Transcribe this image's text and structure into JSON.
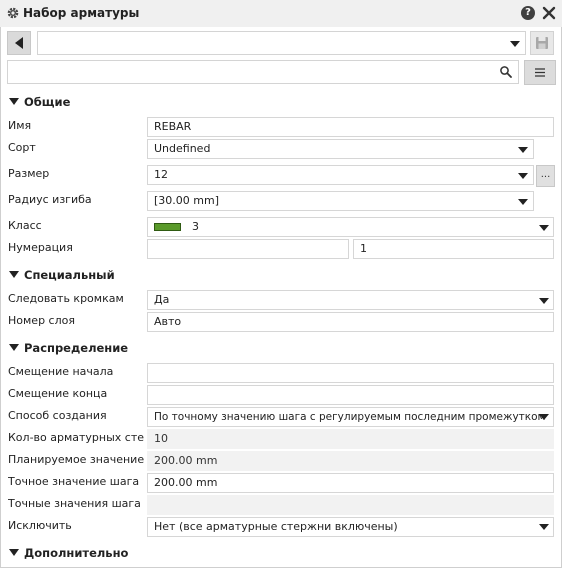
{
  "window": {
    "title": "Набор арматуры",
    "help_label": "?"
  },
  "toolbar": {
    "preset_value": "",
    "search_value": "",
    "ellipsis_label": "..."
  },
  "sections": {
    "general": "Общие",
    "special": "Специальный",
    "distribution": "Распределение",
    "additional": "Дополнительно"
  },
  "general": {
    "name_label": "Имя",
    "name_value": "REBAR",
    "grade_label": "Сорт",
    "grade_value": "Undefined",
    "size_label": "Размер",
    "size_value": "12",
    "bend_radius_label": "Радиус изгиба",
    "bend_radius_value": "[30.00 mm]",
    "class_label": "Класс",
    "class_value": "3",
    "class_color": "#5a9a2a",
    "numbering_label": "Нумерация",
    "numbering_prefix": "",
    "numbering_start": "1"
  },
  "special": {
    "follow_edges_label": "Следовать кромкам",
    "follow_edges_value": "Да",
    "layer_number_label": "Номер слоя",
    "layer_number_value": "Авто"
  },
  "distribution": {
    "start_offset_label": "Смещение начала",
    "start_offset_value": "",
    "end_offset_label": "Смещение конца",
    "end_offset_value": "",
    "creation_method_label": "Способ создания",
    "creation_method_value": "По точному значению шага с регулируемым последним промежутком",
    "bar_count_label": "Кол-во арматурных сте...",
    "bar_count_value": "10",
    "planned_label": "Планируемое значение...",
    "planned_value": "200.00 mm",
    "exact_spacing_label": "Точное значение шага",
    "exact_spacing_value": "200.00 mm",
    "exact_spacings_label": "Точные значения шага",
    "exact_spacings_value": "",
    "exclude_label": "Исключить",
    "exclude_value": "Нет (все арматурные стержни включены)"
  }
}
